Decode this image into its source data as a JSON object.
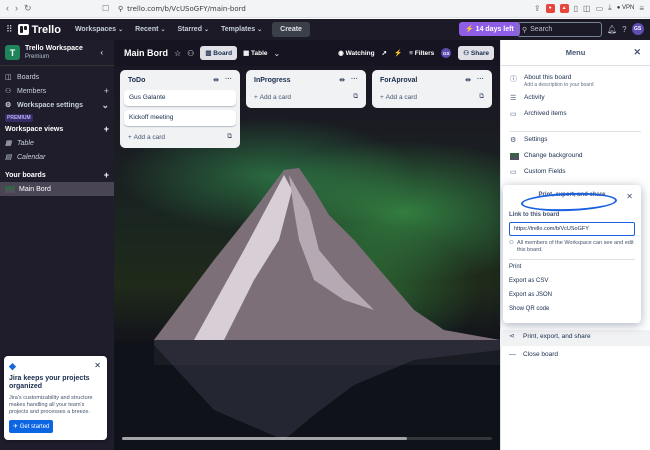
{
  "browser": {
    "url": "trello.com/b/VcUSoGFY/main-bord",
    "vpn_label": "VPN"
  },
  "header": {
    "brand": "Trello",
    "menu": [
      "Workspaces",
      "Recent",
      "Starred",
      "Templates"
    ],
    "create_label": "Create",
    "trial_label": "14 days left",
    "search_placeholder": "Search",
    "avatar_initials": "GS"
  },
  "sidebar": {
    "workspace_name": "Trello Workspace",
    "workspace_plan": "Premium",
    "workspace_initial": "T",
    "items": [
      {
        "label": "Boards"
      },
      {
        "label": "Members"
      },
      {
        "label": "Workspace settings"
      }
    ],
    "premium_tag": "PREMIUM",
    "views_heading": "Workspace views",
    "views": [
      {
        "label": "Table"
      },
      {
        "label": "Calendar"
      }
    ],
    "boards_heading": "Your boards",
    "boards": [
      {
        "label": "Main Bord"
      }
    ]
  },
  "jira_promo": {
    "title": "Jira keeps your projects organized",
    "description": "Jira's customizability and structure makes handling all your team's projects and processes a breeze.",
    "button": "Get started"
  },
  "board": {
    "title": "Main Bord",
    "view_board": "Board",
    "view_table": "Table",
    "watching": "Watching",
    "filters": "Filters",
    "share": "Share",
    "avatar_initials": "GS",
    "lists": [
      {
        "title": "ToDo",
        "cards": [
          "Gus Galante",
          "Kickoff meeting"
        ],
        "add_label": "Add a card"
      },
      {
        "title": "InProgress",
        "cards": [],
        "add_label": "Add a card"
      },
      {
        "title": "ForAproval",
        "cards": [],
        "add_label": "Add a card"
      }
    ]
  },
  "menu": {
    "title": "Menu",
    "about_title": "About this board",
    "about_sub": "Add a description to your board",
    "activity": "Activity",
    "archived": "Archived items",
    "settings": "Settings",
    "change_background": "Change background",
    "custom_fields": "Custom Fields",
    "print_export": "Print, export, and share",
    "close_board": "Close board"
  },
  "popover": {
    "title": "Print, export, and share",
    "link_label": "Link to this board",
    "link_value": "https://trello.com/b/VcUSoGFY",
    "note": "All members of the Workspace can see and edit this board.",
    "options": [
      "Print",
      "Export as CSV",
      "Export as JSON",
      "Show QR code"
    ]
  }
}
